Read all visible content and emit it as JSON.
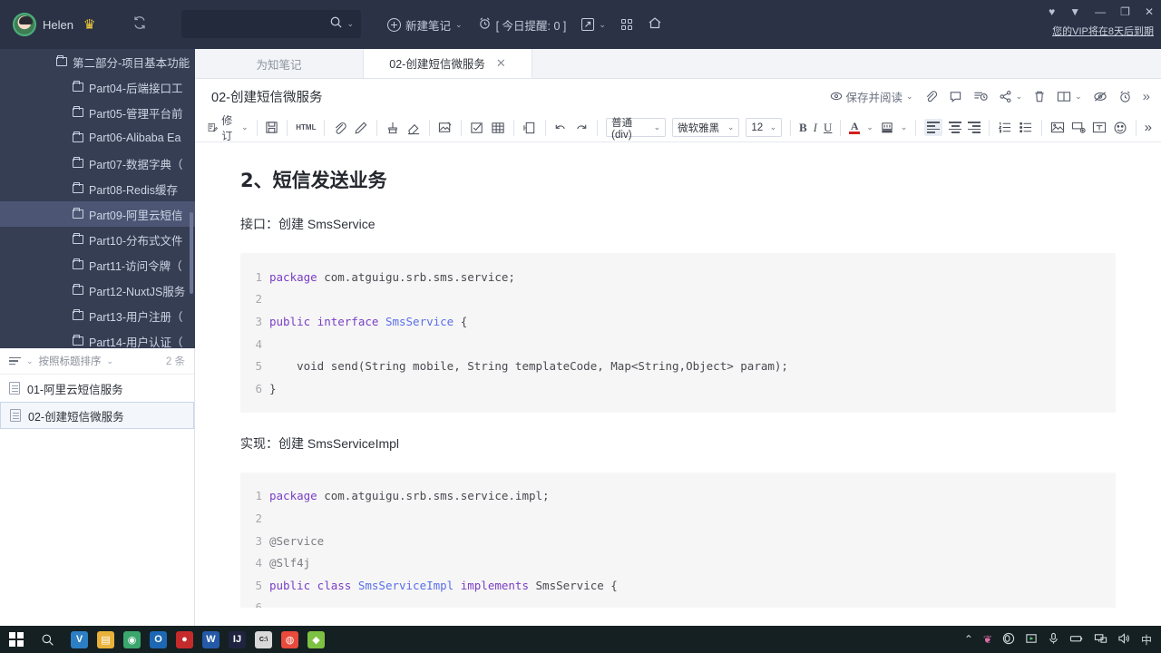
{
  "topbar": {
    "user_name": "Helen",
    "crown_icon": "crown-icon",
    "sync_icon": "sync-icon",
    "search_placeholder": "",
    "search_value": "",
    "new_note_label": "新建笔记",
    "reminder_label": "[ 今日提醒: 0 ]",
    "vip_notice": "您的VIP将在8天后到期",
    "window_buttons": [
      "—",
      "❐",
      "✕"
    ]
  },
  "sidebar": {
    "items": [
      {
        "label": "第二部分-项目基本功能",
        "level": 1,
        "selected": false
      },
      {
        "label": "Part04-后端接口工",
        "level": 2,
        "selected": false
      },
      {
        "label": "Part05-管理平台前",
        "level": 2,
        "selected": false
      },
      {
        "label": "Part06-Alibaba Ea",
        "level": 2,
        "selected": false
      },
      {
        "label": "Part07-数据字典（",
        "level": 2,
        "selected": false
      },
      {
        "label": "Part08-Redis缓存",
        "level": 2,
        "selected": false
      },
      {
        "label": "Part09-阿里云短信",
        "level": 2,
        "selected": true
      },
      {
        "label": "Part10-分布式文件",
        "level": 2,
        "selected": false
      },
      {
        "label": "Part11-访问令牌（",
        "level": 2,
        "selected": false
      },
      {
        "label": "Part12-NuxtJS服务",
        "level": 2,
        "selected": false
      },
      {
        "label": "Part13-用户注册（",
        "level": 2,
        "selected": false
      },
      {
        "label": "Part14-用户认证（",
        "level": 2,
        "selected": false
      }
    ]
  },
  "notelist": {
    "sort_label": "按照标题排序",
    "count_label": "2 条",
    "items": [
      {
        "title": "01-阿里云短信服务",
        "active": false
      },
      {
        "title": "02-创建短信微服务",
        "active": true
      }
    ]
  },
  "tabs": [
    {
      "label": "为知笔记",
      "active": false,
      "closable": false
    },
    {
      "label": "02-创建短信微服务",
      "active": true,
      "closable": true
    }
  ],
  "doc": {
    "title": "02-创建短信微服务",
    "right_tools": {
      "save_read_label": "保存并阅读",
      "icons": [
        "eye-icon",
        "attachment-icon",
        "comment-icon",
        "history-icon",
        "share-icon",
        "delete-icon",
        "split-view-icon",
        "no-distraction-icon",
        "alarm-icon",
        "more-icon"
      ]
    }
  },
  "format_toolbar": {
    "revision_label": "修订",
    "style_select": "普通 (div)",
    "font_select": "微软雅黑",
    "size_select": "12",
    "bold": "B",
    "italic": "I",
    "underline": "U",
    "more": "»",
    "icons": [
      "save-icon",
      "html-icon",
      "link-icon",
      "pen-icon",
      "format-brush-icon",
      "eraser-icon",
      "image-edit-icon",
      "checkbox-icon",
      "table-icon",
      "page-icon",
      "undo-icon",
      "redo-icon",
      "text-color-icon",
      "highlight-icon",
      "align-left-icon",
      "align-center-icon",
      "align-right-icon",
      "ordered-list-icon",
      "unordered-list-icon",
      "insert-image-icon",
      "insert-attachment-icon",
      "insert-textbox-icon",
      "emoji-icon"
    ]
  },
  "content": {
    "heading": "2、短信发送业务",
    "para1": "接口：创建 SmsService",
    "para2": "实现：创建 SmsServiceImpl",
    "code1": {
      "lines": [
        {
          "no": "1",
          "segments": [
            {
              "t": "package",
              "c": "kw"
            },
            {
              "t": " com.atguigu.srb.sms.service;",
              "c": ""
            }
          ]
        },
        {
          "no": "2",
          "segments": [
            {
              "t": "",
              "c": ""
            }
          ]
        },
        {
          "no": "3",
          "segments": [
            {
              "t": "public interface ",
              "c": "kw"
            },
            {
              "t": "SmsService",
              "c": "typ"
            },
            {
              "t": " {",
              "c": ""
            }
          ]
        },
        {
          "no": "4",
          "segments": [
            {
              "t": "",
              "c": ""
            }
          ]
        },
        {
          "no": "5",
          "segments": [
            {
              "t": "    void send(String mobile, String templateCode, Map<String,Object> param);",
              "c": ""
            }
          ]
        },
        {
          "no": "6",
          "segments": [
            {
              "t": "}",
              "c": ""
            }
          ]
        }
      ]
    },
    "code2": {
      "lines": [
        {
          "no": "1",
          "segments": [
            {
              "t": "package",
              "c": "kw"
            },
            {
              "t": " com.atguigu.srb.sms.service.impl;",
              "c": ""
            }
          ]
        },
        {
          "no": "2",
          "segments": [
            {
              "t": "",
              "c": ""
            }
          ]
        },
        {
          "no": "3",
          "segments": [
            {
              "t": "@Service",
              "c": "ann"
            }
          ]
        },
        {
          "no": "4",
          "segments": [
            {
              "t": "@Slf4j",
              "c": "ann"
            }
          ]
        },
        {
          "no": "5",
          "segments": [
            {
              "t": "public class ",
              "c": "kw"
            },
            {
              "t": "SmsServiceImpl",
              "c": "typ"
            },
            {
              "t": " implements ",
              "c": "kw"
            },
            {
              "t": "SmsService {",
              "c": ""
            }
          ]
        },
        {
          "no": "6",
          "segments": [
            {
              "t": "",
              "c": ""
            }
          ]
        }
      ]
    }
  },
  "taskbar": {
    "start_icon": "windows-start-icon",
    "search_icon": "search-icon",
    "apps": [
      {
        "name": "vscode-icon",
        "glyph": "V",
        "color": "#2c7fc4"
      },
      {
        "name": "file-explorer-icon",
        "glyph": "▤",
        "color": "#e8b23a"
      },
      {
        "name": "chrome-canary-icon",
        "glyph": "◉",
        "color": "#3aa76d"
      },
      {
        "name": "outlook-icon",
        "glyph": "O",
        "color": "#1c68b4"
      },
      {
        "name": "media-player-icon",
        "glyph": "●",
        "color": "#c62b2b"
      },
      {
        "name": "word-icon",
        "glyph": "W",
        "color": "#2459a8"
      },
      {
        "name": "intellij-icon",
        "glyph": "IJ",
        "color": "#1f2340"
      },
      {
        "name": "terminal-icon",
        "glyph": "C:\\",
        "color": "#d9d9d9"
      },
      {
        "name": "chrome-icon",
        "glyph": "◍",
        "color": "#e84a3b"
      },
      {
        "name": "wiznote-icon",
        "glyph": "◆",
        "color": "#7dc242"
      }
    ],
    "tray": [
      "chevron-up-icon",
      "app-icon",
      "obs-icon",
      "screencast-icon",
      "mic-icon",
      "battery-icon",
      "network-icon",
      "volume-icon"
    ],
    "ime_label": "中"
  },
  "colors": {
    "topbar_bg": "#2b3245",
    "sidebar_bg": "#363e54",
    "sidebar_selected": "#4c5674",
    "taskbar_bg": "#152022",
    "code_bg": "#f6f6f7",
    "accent_keyword": "#7a3fc4",
    "accent_type": "#5b6fe8"
  }
}
